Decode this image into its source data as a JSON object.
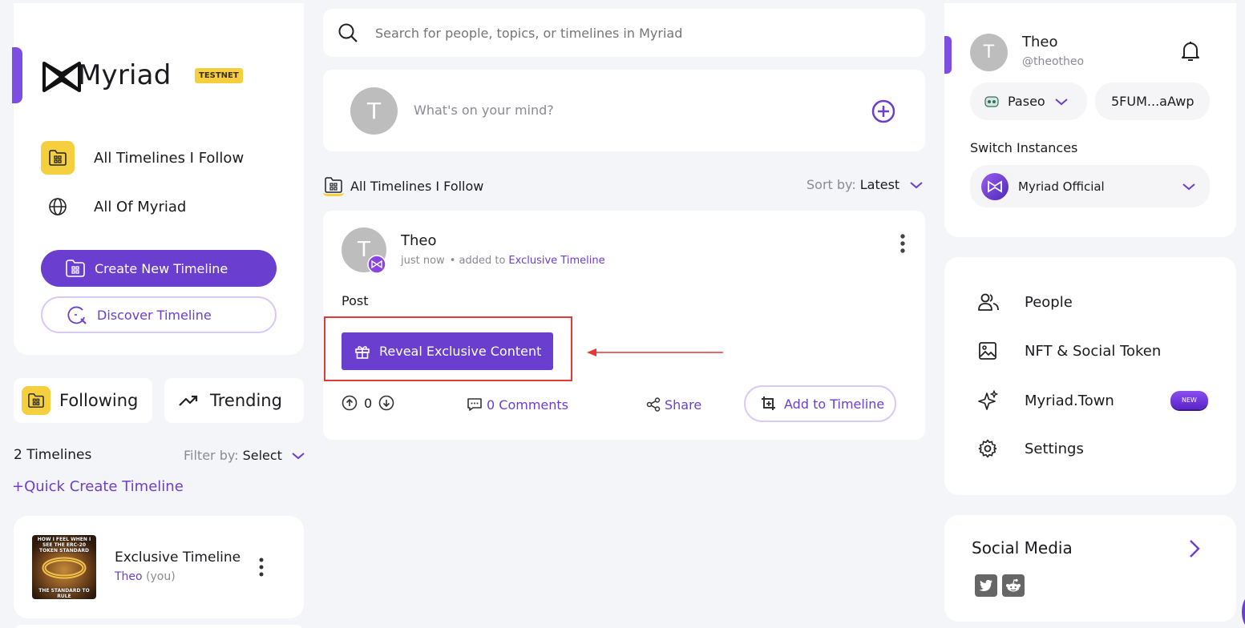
{
  "brand": {
    "name": "Myriad",
    "badge": "TESTNET"
  },
  "left_nav": {
    "items": [
      {
        "label": "All Timelines I Follow",
        "icon": "folder-grid-icon"
      },
      {
        "label": "All Of Myriad",
        "icon": "globe-icon"
      }
    ],
    "create_button": "Create New Timeline",
    "discover_button": "Discover Timeline"
  },
  "tabs": [
    {
      "label": "Following",
      "icon": "folder-grid-icon"
    },
    {
      "label": "Trending",
      "icon": "trending-up-icon"
    }
  ],
  "timelines": {
    "count_label": "2 Timelines",
    "filter_label": "Filter by:",
    "filter_value": "Select",
    "quick_create": "+Quick Create Timeline",
    "items": [
      {
        "name": "Exclusive Timeline",
        "owner": "Theo",
        "owner_suffix": "(you)",
        "thumb_top": "HOW I FEEL WHEN I SEE THE ERC-20 TOKEN STANDARD",
        "thumb_bottom": "THE STANDARD TO RULE"
      }
    ]
  },
  "search": {
    "placeholder": "Search for people, topics, or timelines in Myriad"
  },
  "compose": {
    "avatar_letter": "T",
    "placeholder": "What's on your mind?"
  },
  "feed": {
    "title": "All Timelines I Follow",
    "sort_label": "Sort by:",
    "sort_value": "Latest"
  },
  "post": {
    "author": "Theo",
    "avatar_letter": "T",
    "time": "just now",
    "added_to_prefix": "• added to",
    "timeline": "Exclusive Timeline",
    "body": "Post",
    "reveal_button": "Reveal Exclusive Content",
    "votes": "0",
    "comments": "0 Comments",
    "share": "Share",
    "add_to_timeline": "Add to Timeline"
  },
  "profile": {
    "name": "Theo",
    "handle": "@theotheo",
    "avatar_letter": "T",
    "network": "Paseo",
    "address": "5FUM...aAwp",
    "switch_label": "Switch Instances",
    "instance": "Myriad Official"
  },
  "right_menu": [
    {
      "label": "People",
      "icon": "people-icon"
    },
    {
      "label": "NFT & Social Token",
      "icon": "image-icon"
    },
    {
      "label": "Myriad.Town",
      "icon": "sparkle-icon",
      "badge": "NEW"
    },
    {
      "label": "Settings",
      "icon": "gear-icon"
    }
  ],
  "social": {
    "title": "Social Media",
    "icons": [
      "twitter-icon",
      "reddit-icon"
    ]
  },
  "colors": {
    "accent": "#6a3fd0",
    "brand_yellow": "#f6cf3f",
    "annotation_red": "#e53935"
  }
}
